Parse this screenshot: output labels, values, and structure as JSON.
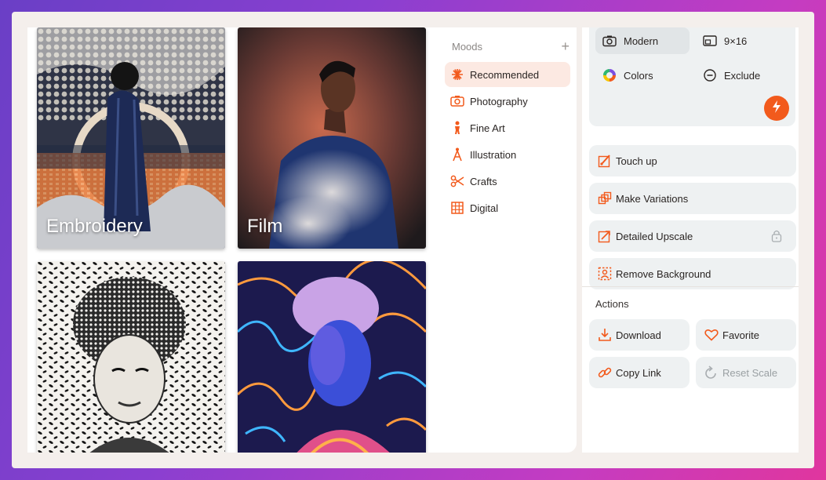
{
  "gallery": {
    "tiles": [
      {
        "label": "Embroidery"
      },
      {
        "label": "Film"
      },
      {
        "label": ""
      },
      {
        "label": ""
      }
    ]
  },
  "moods": {
    "title": "Moods",
    "add_symbol": "+",
    "items": [
      {
        "label": "Recommended",
        "icon": "sunburst-icon",
        "active": true
      },
      {
        "label": "Photography",
        "icon": "camera-icon",
        "active": false
      },
      {
        "label": "Fine Art",
        "icon": "figure-icon",
        "active": false
      },
      {
        "label": "Illustration",
        "icon": "compass-icon",
        "active": false
      },
      {
        "label": "Crafts",
        "icon": "scissors-icon",
        "active": false
      },
      {
        "label": "Digital",
        "icon": "grid-icon",
        "active": false
      }
    ]
  },
  "settings": {
    "style": "Modern",
    "aspect": "9×16",
    "colors": "Colors",
    "exclude": "Exclude"
  },
  "tools": {
    "touch_up": "Touch up",
    "make_variations": "Make Variations",
    "detailed_upscale": "Detailed Upscale",
    "remove_background": "Remove Background"
  },
  "actions": {
    "title": "Actions",
    "download": "Download",
    "favorite": "Favorite",
    "copy_link": "Copy Link",
    "reset_scale": "Reset Scale"
  },
  "colors": {
    "accent": "#f25a1c",
    "active_bg": "#fce9e2",
    "button_bg": "#eef1f2"
  }
}
